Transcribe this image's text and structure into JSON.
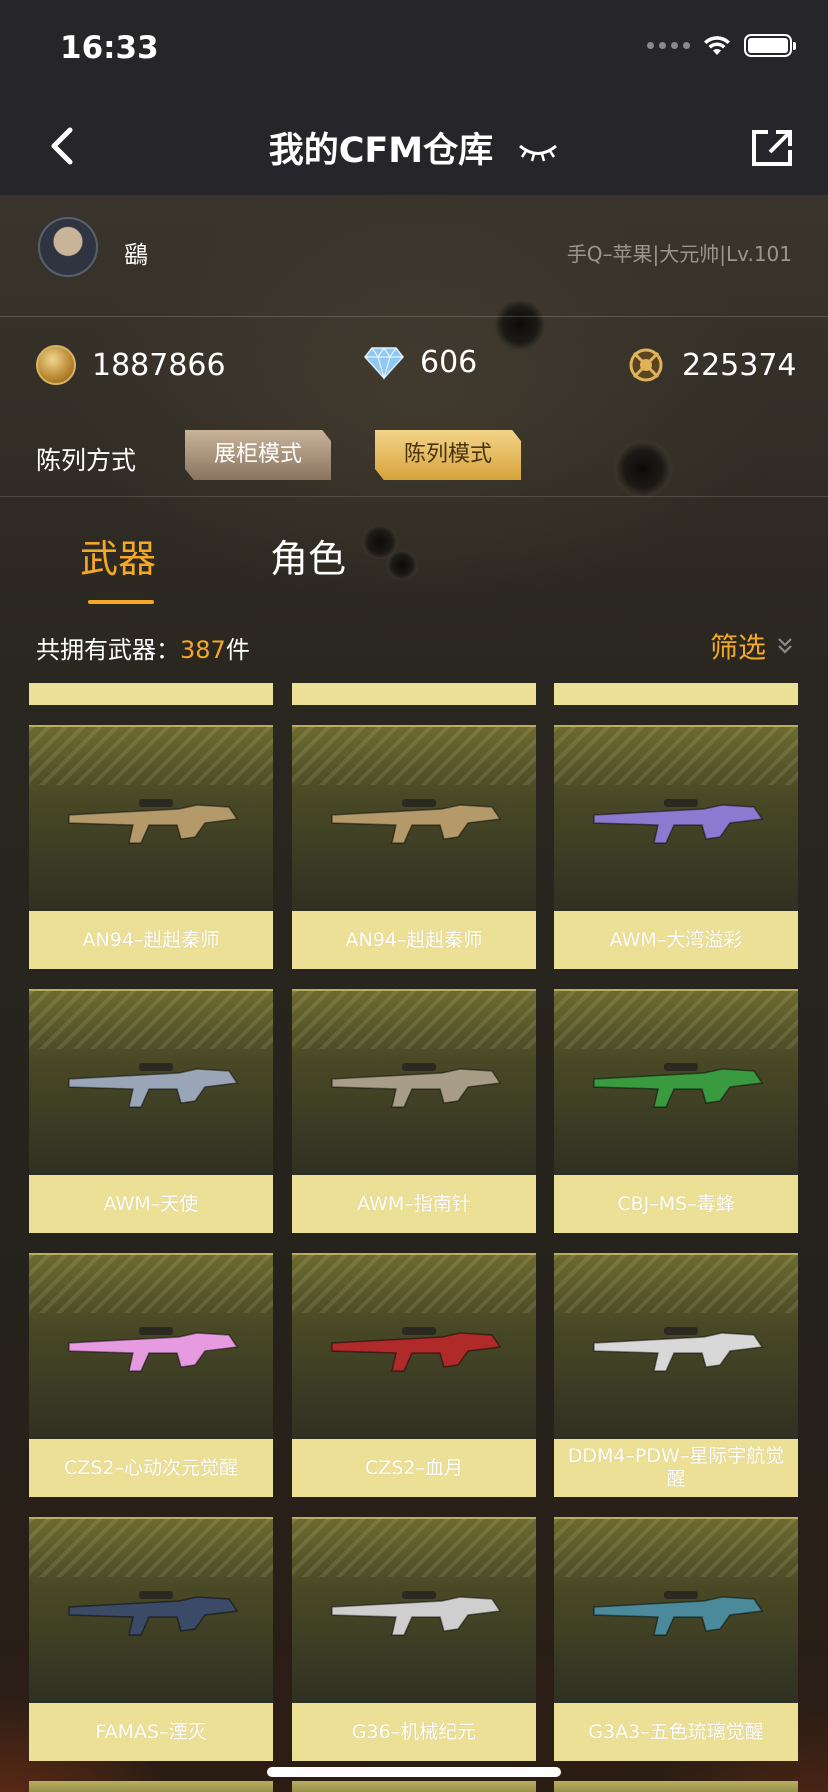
{
  "status": {
    "time": "16:33"
  },
  "nav": {
    "title": "我的CFM仓库"
  },
  "profile": {
    "username": "鷂",
    "server_info": "手Q–苹果|大元帅|Lv.101"
  },
  "currencies": {
    "gold": "1887866",
    "diamond": "606",
    "badge": "225374"
  },
  "display_mode": {
    "label": "陈列方式",
    "showcase": "展柜模式",
    "list": "陈列模式"
  },
  "tabs": {
    "weapons": "武器",
    "role": "角色"
  },
  "inventory": {
    "count_prefix": "共拥有武器：",
    "count": "387",
    "count_suffix": "件",
    "filter": "筛选"
  },
  "weapons": [
    {
      "name": "AN94–赳赳秦师",
      "color": "#b49a6a"
    },
    {
      "name": "AN94–赳赳秦师",
      "color": "#b49a6a"
    },
    {
      "name": "AWM–大湾溢彩",
      "color": "#8a7ad0"
    },
    {
      "name": "AWM–天使",
      "color": "#9aa6b8"
    },
    {
      "name": "AWM–指南针",
      "color": "#a89d86"
    },
    {
      "name": "CBJ–MS–毒蜂",
      "color": "#3a9a40"
    },
    {
      "name": "CZS2–心动次元觉醒",
      "color": "#e69ae0"
    },
    {
      "name": "CZS2–血月",
      "color": "#b02a2a"
    },
    {
      "name": "DDM4–PDW–星际宇航觉醒",
      "color": "#d8d8d8"
    },
    {
      "name": "FAMAS–湮灭",
      "color": "#3b4a66"
    },
    {
      "name": "G36–机械纪元",
      "color": "#cfcfcf"
    },
    {
      "name": "G3A3–五色琉璃觉醒",
      "color": "#4a8a9a"
    }
  ]
}
